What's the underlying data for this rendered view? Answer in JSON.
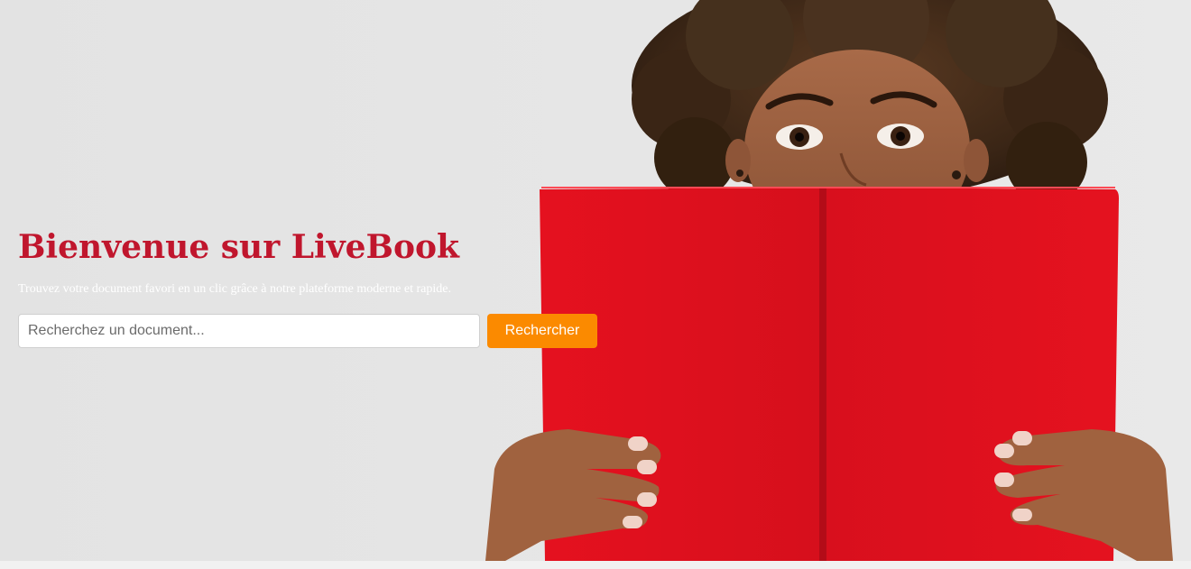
{
  "hero": {
    "title": "Bienvenue sur LiveBook",
    "subtitle": "Trouvez votre document favori en un clic grâce à notre plateforme moderne et rapide.",
    "image_alt": "woman-reading-red-book"
  },
  "search": {
    "placeholder": "Recherchez un document...",
    "value": "",
    "button_label": "Rechercher"
  },
  "colors": {
    "title": "#c0162d",
    "button": "#fb8a00",
    "background": "#e4e4e4",
    "book_red": "#dd1020"
  }
}
